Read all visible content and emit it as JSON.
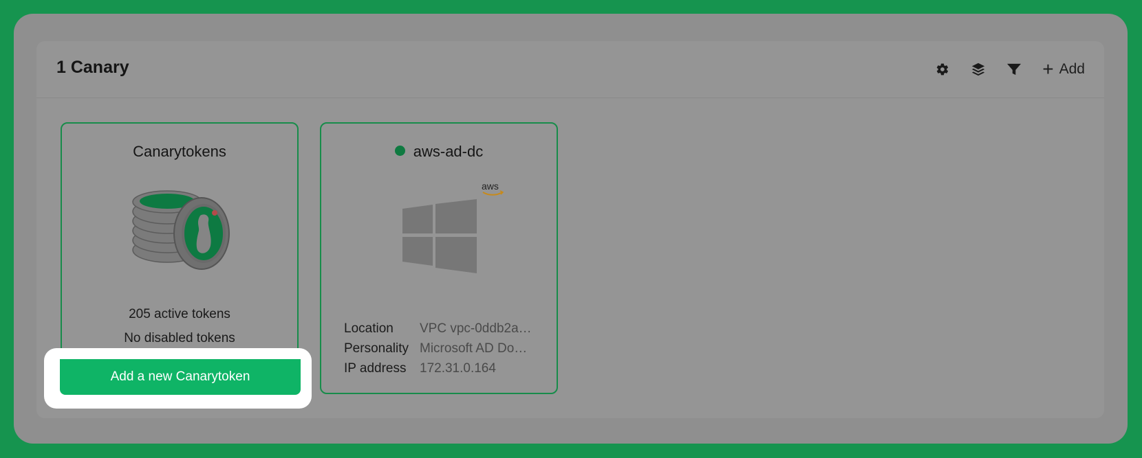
{
  "panel": {
    "title": "1 Canary",
    "actions": {
      "settings_icon": "gear-icon",
      "layers_icon": "layers-icon",
      "filter_icon": "filter-icon",
      "add_label": "Add"
    }
  },
  "tokens_card": {
    "title": "Canarytokens",
    "active_tokens": "205 active tokens",
    "disabled_tokens": "No disabled tokens",
    "cta_label": "Add a new Canarytoken"
  },
  "device_card": {
    "name": "aws-ad-dc",
    "status_color": "#0f7a41",
    "aws_label": "aws",
    "details": [
      {
        "key": "Location",
        "value": "VPC vpc-0ddb2a…"
      },
      {
        "key": "Personality",
        "value": "Microsoft AD Do…"
      },
      {
        "key": "IP address",
        "value": "172.31.0.164"
      }
    ]
  },
  "colors": {
    "background": "#16944f",
    "accent": "#0fb466",
    "card_border": "#178c4a"
  }
}
